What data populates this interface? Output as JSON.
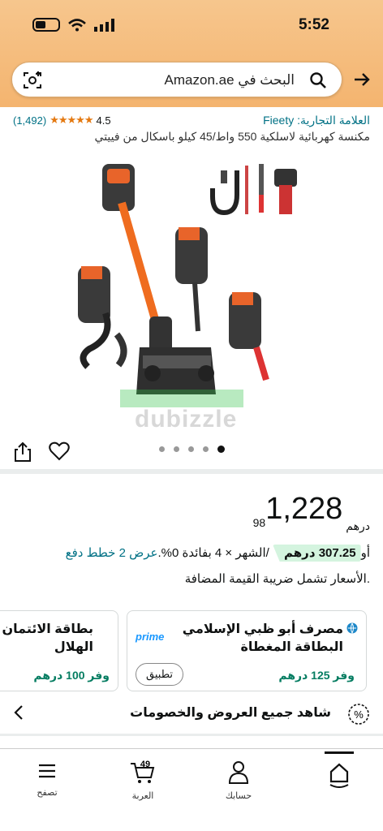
{
  "status_bar": {
    "time": "5:52"
  },
  "search": {
    "placeholder": "البحث في Amazon.ae"
  },
  "product": {
    "brand": "العلامة التجارية: Fieety",
    "rating": "4.5",
    "rating_count": "(1,492)",
    "title": "مكنسة كهربائية لاسلكية 550 واط/45 كيلو باسكال من فييتي",
    "watermark": "dubizzle"
  },
  "price": {
    "currency": "درهم",
    "whole": "1,228",
    "fraction": "98",
    "installment_prefix": "أو",
    "installment_amount": "307.25 درهم",
    "installment_text": " /الشهر × 4 بفائدة 0%.",
    "installment_link": "عرض 2 خطط دفع",
    "vat_note": ".الأسعار تشمل ضريبة القيمة المضافة"
  },
  "cards": [
    {
      "title_line1": "مصرف أبو ظبي الإسلامي",
      "title_line2": "البطاقة المغطاة",
      "badge": "prime",
      "save": "وفر 125 درهم",
      "button": "تطبيق"
    },
    {
      "title_line1": "بطاقة الائتمان ما",
      "title_line2": "الهلال",
      "save": "وفر 100 درهم"
    }
  ],
  "offers_link": "شاهد جميع العروض والخصومات",
  "gallery": {
    "dot_count": 5,
    "active_dot": 4
  },
  "bottom_nav": {
    "home": "",
    "account": "حسابك",
    "cart": "العربة",
    "cart_count": "49",
    "browse": "تصفح"
  },
  "colors": {
    "header": "#f5bd7e",
    "link": "#007185",
    "star": "#e47911",
    "save": "#067d62",
    "install_bg": "#d4f4df"
  }
}
